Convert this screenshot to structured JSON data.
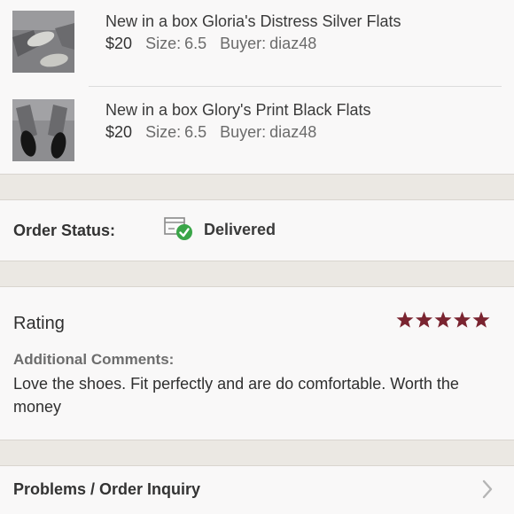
{
  "items": [
    {
      "title": "New in a box Gloria's Distress Silver Flats",
      "price": "$20",
      "size_label": "Size:",
      "size": "6.5",
      "buyer_label": "Buyer:",
      "buyer": "diaz48"
    },
    {
      "title": "New in a box Glory's Print Black Flats",
      "price": "$20",
      "size_label": "Size:",
      "size": "6.5",
      "buyer_label": "Buyer:",
      "buyer": "diaz48"
    }
  ],
  "order_status": {
    "label": "Order Status:",
    "value": "Delivered",
    "icon": "box-check-icon"
  },
  "rating": {
    "label": "Rating",
    "stars": 5,
    "max_stars": 5,
    "star_color": "#7a2430",
    "comments_label": "Additional Comments:",
    "comments": "Love the shoes. Fit perfectly and are do comfortable. Worth the money"
  },
  "problems": {
    "label": "Problems / Order Inquiry",
    "icon": "chevron-right-icon"
  },
  "colors": {
    "background": "#ece9e4",
    "card": "#f9f8f8",
    "check_green": "#3aa548"
  }
}
